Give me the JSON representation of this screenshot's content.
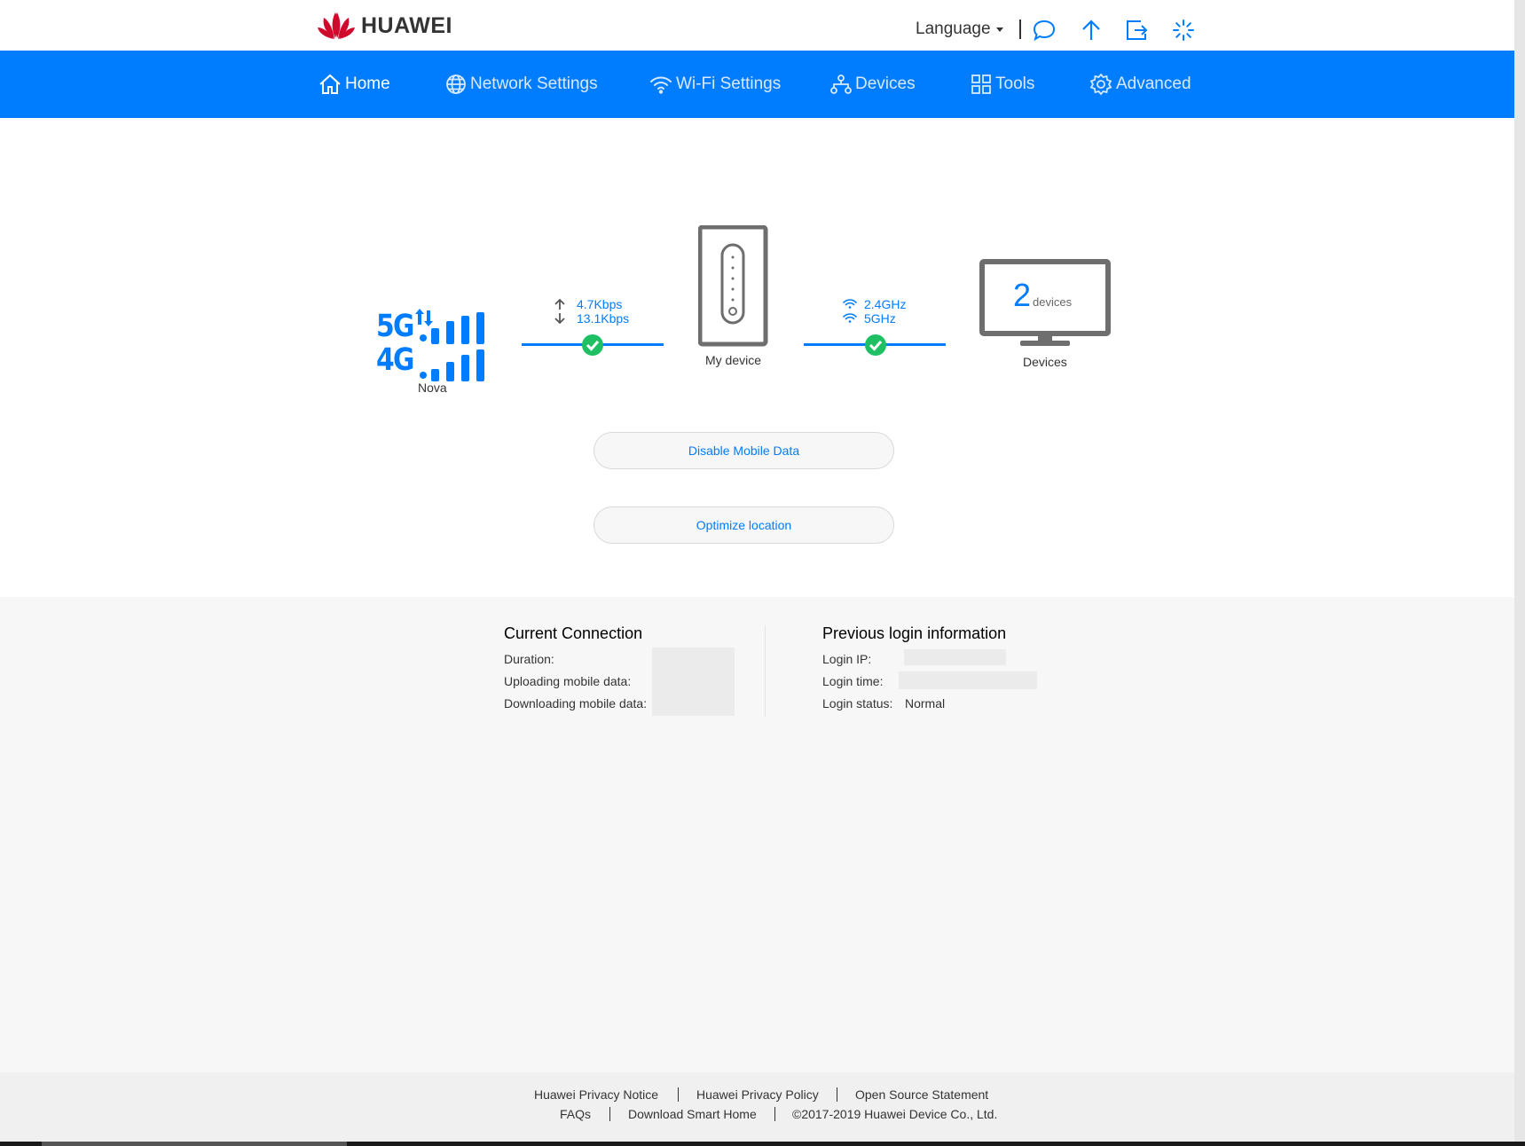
{
  "header": {
    "brand": "HUAWEI",
    "language_label": "Language",
    "icons": [
      "message-icon",
      "upload-icon",
      "logout-icon",
      "loading-icon"
    ]
  },
  "nav": {
    "items": [
      {
        "label": "Home",
        "icon": "home-icon",
        "active": true
      },
      {
        "label": "Network Settings",
        "icon": "globe-icon"
      },
      {
        "label": "Wi-Fi Settings",
        "icon": "wifi-icon"
      },
      {
        "label": "Devices",
        "icon": "devices-icon"
      },
      {
        "label": "Tools",
        "icon": "tools-icon"
      },
      {
        "label": "Advanced",
        "icon": "gear-icon"
      }
    ]
  },
  "status": {
    "network_5g": "5G",
    "network_4g": "4G",
    "carrier": "Nova",
    "upload_rate": "4.7Kbps",
    "download_rate": "13.1Kbps",
    "my_device_label": "My device",
    "band_24": "2.4GHz",
    "band_5": "5GHz",
    "device_count": "2",
    "device_count_unit": "devices",
    "devices_label": "Devices"
  },
  "actions": {
    "disable_mobile_data": "Disable Mobile Data",
    "optimize_location": "Optimize location"
  },
  "current_connection": {
    "title": "Current Connection",
    "duration_label": "Duration:",
    "uploading_label": "Uploading mobile data:",
    "downloading_label": "Downloading mobile data:"
  },
  "previous_login": {
    "title": "Previous login information",
    "ip_label": "Login IP:",
    "time_label": "Login time:",
    "status_label": "Login status:",
    "status_value": "Normal"
  },
  "footer": {
    "privacy_notice": "Huawei Privacy Notice",
    "privacy_policy": "Huawei Privacy Policy",
    "open_source": "Open Source Statement",
    "faqs": "FAQs",
    "download_smart_home": "Download Smart Home",
    "copyright": "©2017-2019 Huawei Device Co., Ltd."
  },
  "colors": {
    "accent": "#007dff",
    "success": "#1ec063",
    "brand_red": "#cf0a2c"
  }
}
